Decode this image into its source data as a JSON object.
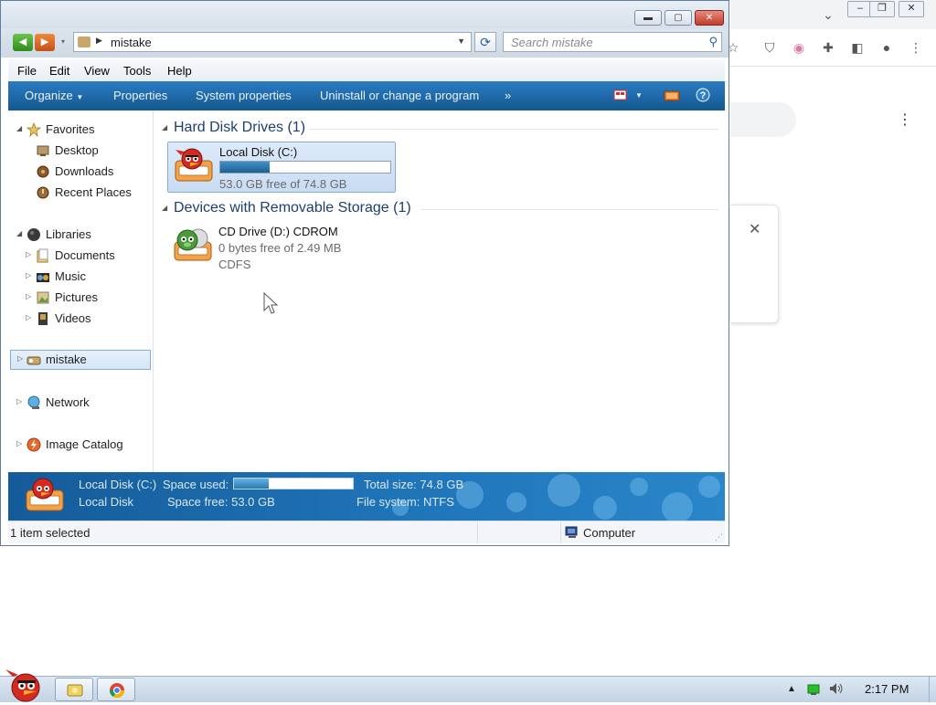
{
  "window": {
    "title_buttons": [
      "minimize",
      "maximize",
      "close"
    ]
  },
  "nav": {
    "address_path": "mistake",
    "search_placeholder": "Search mistake"
  },
  "menu": [
    "File",
    "Edit",
    "View",
    "Tools",
    "Help"
  ],
  "commands": {
    "organize": "Organize",
    "properties": "Properties",
    "system_properties": "System properties",
    "uninstall": "Uninstall or change a program",
    "more": "»"
  },
  "sidebar": {
    "favorites": {
      "label": "Favorites",
      "items": [
        "Desktop",
        "Downloads",
        "Recent Places"
      ]
    },
    "libraries": {
      "label": "Libraries",
      "items": [
        "Documents",
        "Music",
        "Pictures",
        "Videos"
      ]
    },
    "computer": "mistake",
    "network": "Network",
    "image_catalog": "Image Catalog"
  },
  "groups": [
    {
      "title": "Hard Disk Drives (1)",
      "drives": [
        {
          "name": "Local Disk (C:)",
          "free_text": "53.0 GB free of 74.8 GB",
          "used_fraction": 0.29,
          "selected": true
        }
      ]
    },
    {
      "title": "Devices with Removable Storage (1)",
      "drives": [
        {
          "name": "CD Drive (D:) CDROM",
          "free_text": "0 bytes free of 2.49 MB",
          "fs": "CDFS",
          "selected": false
        }
      ]
    }
  ],
  "details": {
    "name": "Local Disk (C:)",
    "type": "Local Disk",
    "space_used_label": "Space used:",
    "space_used_fraction": 0.29,
    "total_size": "Total size: 74.8 GB",
    "space_free": "Space free: 53.0 GB",
    "file_system": "File system: NTFS"
  },
  "status": {
    "selection": "1 item selected",
    "location": "Computer"
  },
  "taskbar": {
    "clock": "2:17 PM"
  },
  "colors": {
    "command_bar": "#1f6aab",
    "details_pane": "#1f74b8",
    "progress_fill": "#1d5f94"
  }
}
